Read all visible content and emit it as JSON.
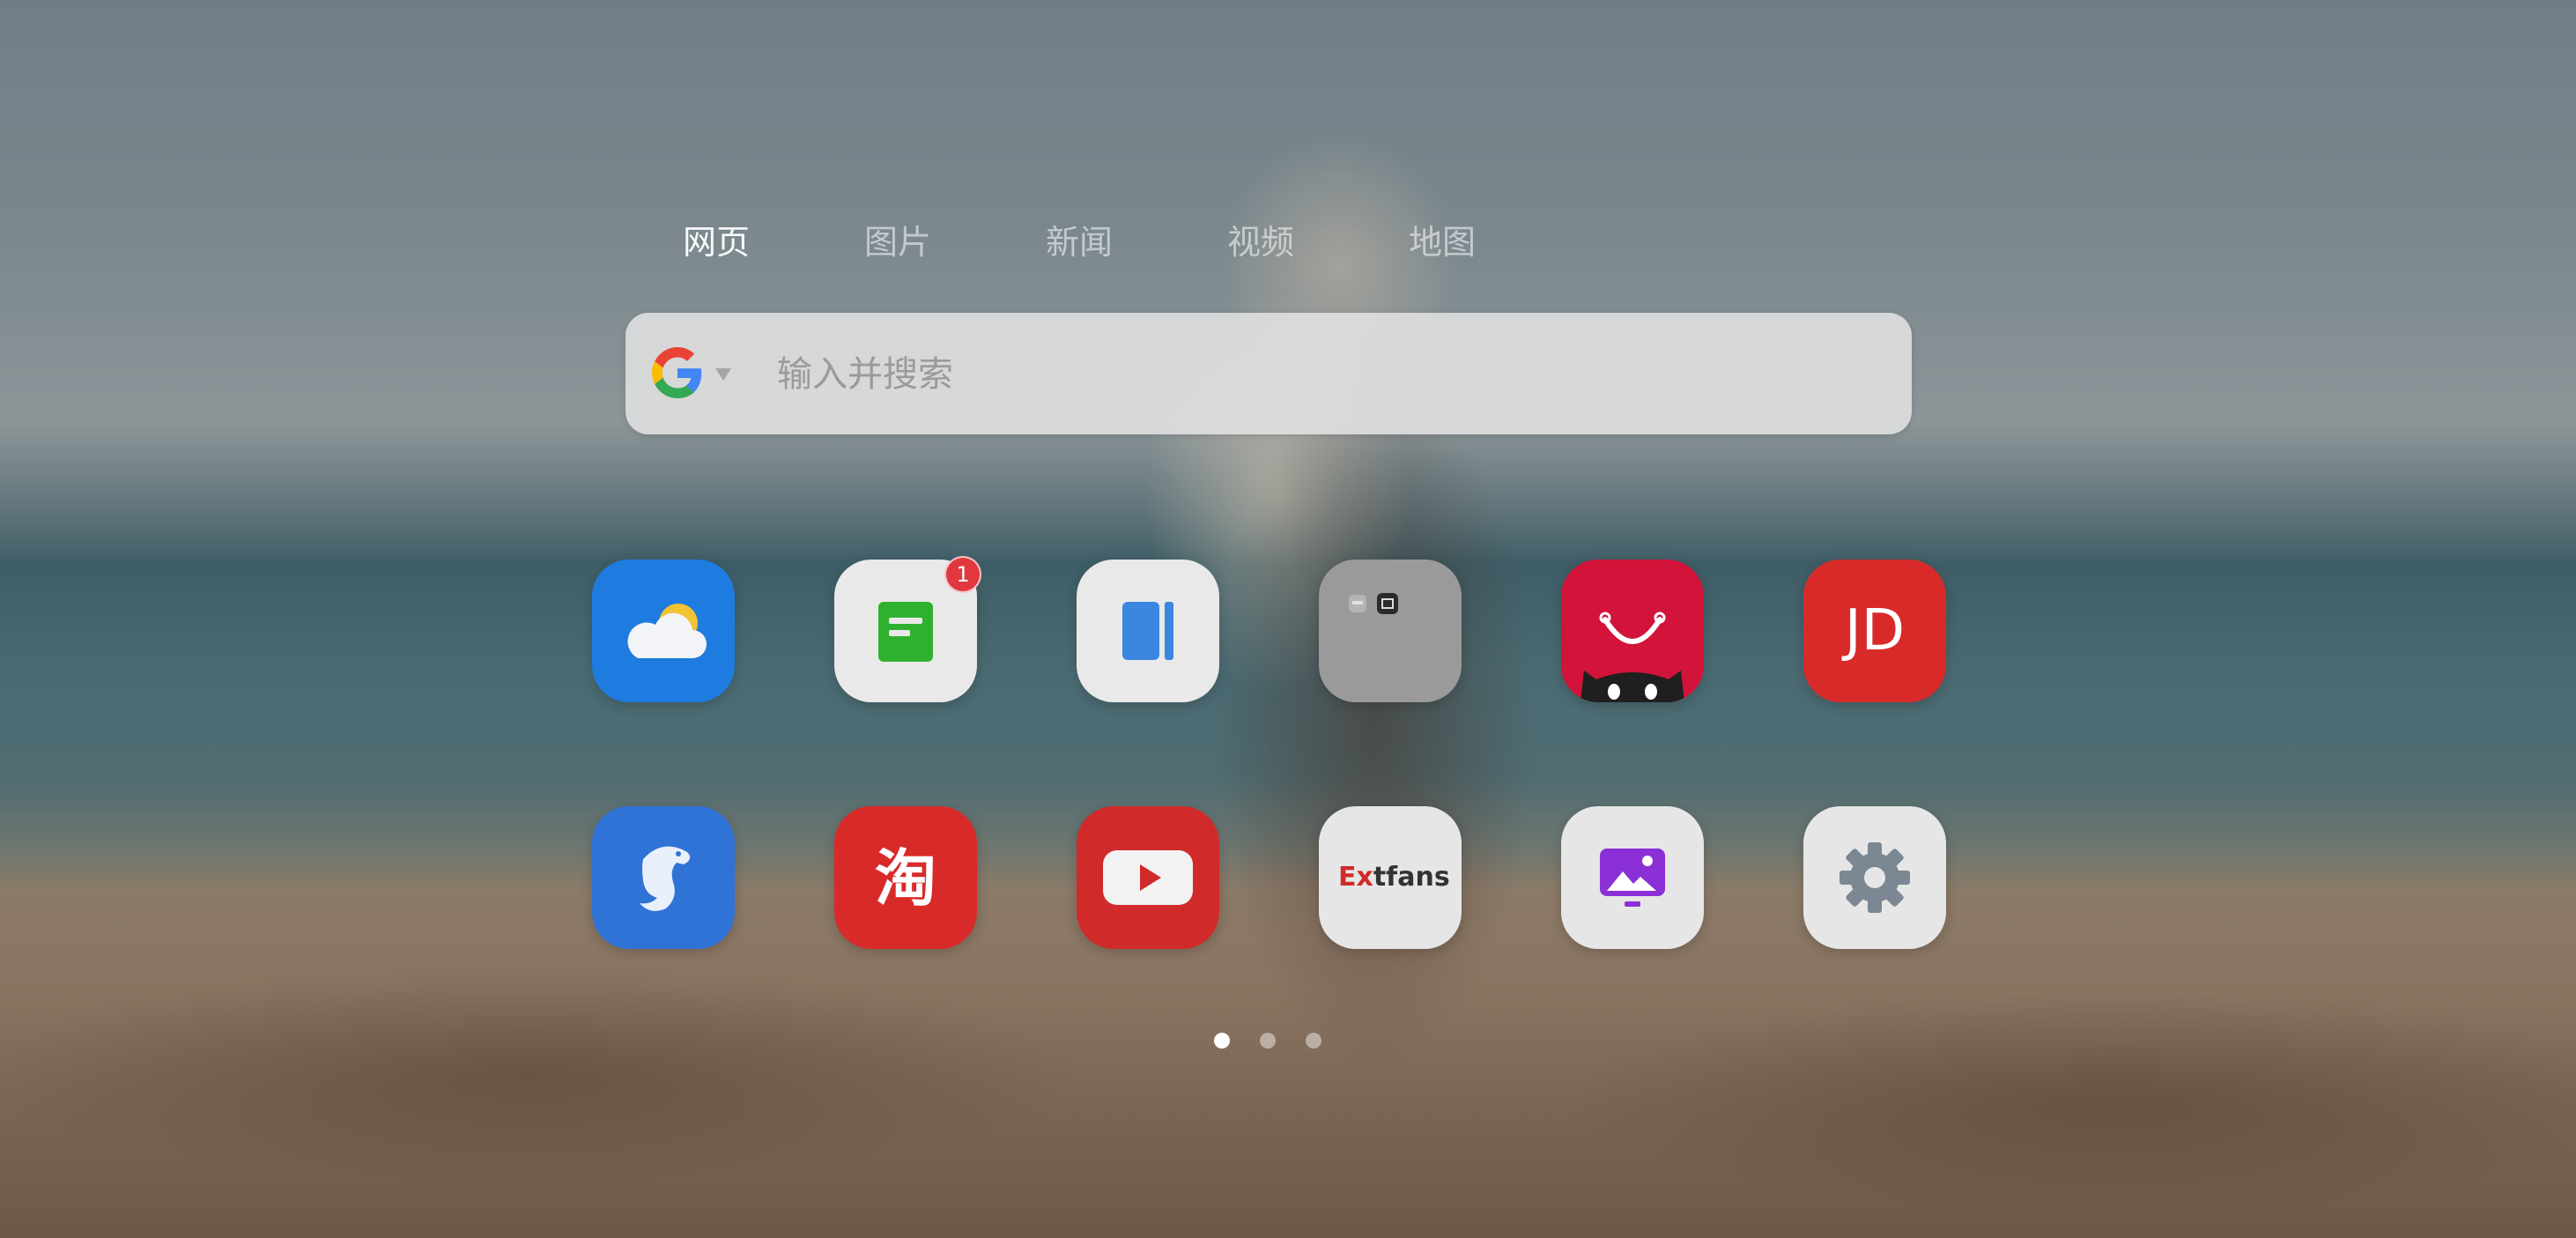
{
  "tabs": [
    {
      "label": "网页",
      "active": true
    },
    {
      "label": "图片",
      "active": false
    },
    {
      "label": "新闻",
      "active": false
    },
    {
      "label": "视频",
      "active": false
    },
    {
      "label": "地图",
      "active": false
    }
  ],
  "search": {
    "engine_icon": "google-icon",
    "placeholder": "输入并搜索",
    "value": ""
  },
  "apps": [
    {
      "icon": "weather-icon",
      "color": "#1e7be0"
    },
    {
      "icon": "notes-icon",
      "color": "#e9e9e9",
      "badge": "1"
    },
    {
      "icon": "sidebar-icon",
      "color": "#e9e9e9"
    },
    {
      "icon": "folder-icon",
      "color": "#9b9b9b"
    },
    {
      "icon": "tmall-icon",
      "color": "#d2133a"
    },
    {
      "icon": "jd-icon",
      "color": "#d92a2a",
      "text": "JD"
    },
    {
      "icon": "ctrip-icon",
      "color": "#2f73d6"
    },
    {
      "icon": "taobao-icon",
      "color": "#d92a2a",
      "text": "淘"
    },
    {
      "icon": "youtube-icon",
      "color": "#d12a2a"
    },
    {
      "icon": "extfans-icon",
      "color": "#e6e6e6",
      "text_red": "Ex",
      "text_dark": "tfans"
    },
    {
      "icon": "wallpaper-icon",
      "color": "#e6e6e6"
    },
    {
      "icon": "settings-icon",
      "color": "#e6e6e6"
    }
  ],
  "pagination": {
    "pages": 3,
    "current": 1
  }
}
